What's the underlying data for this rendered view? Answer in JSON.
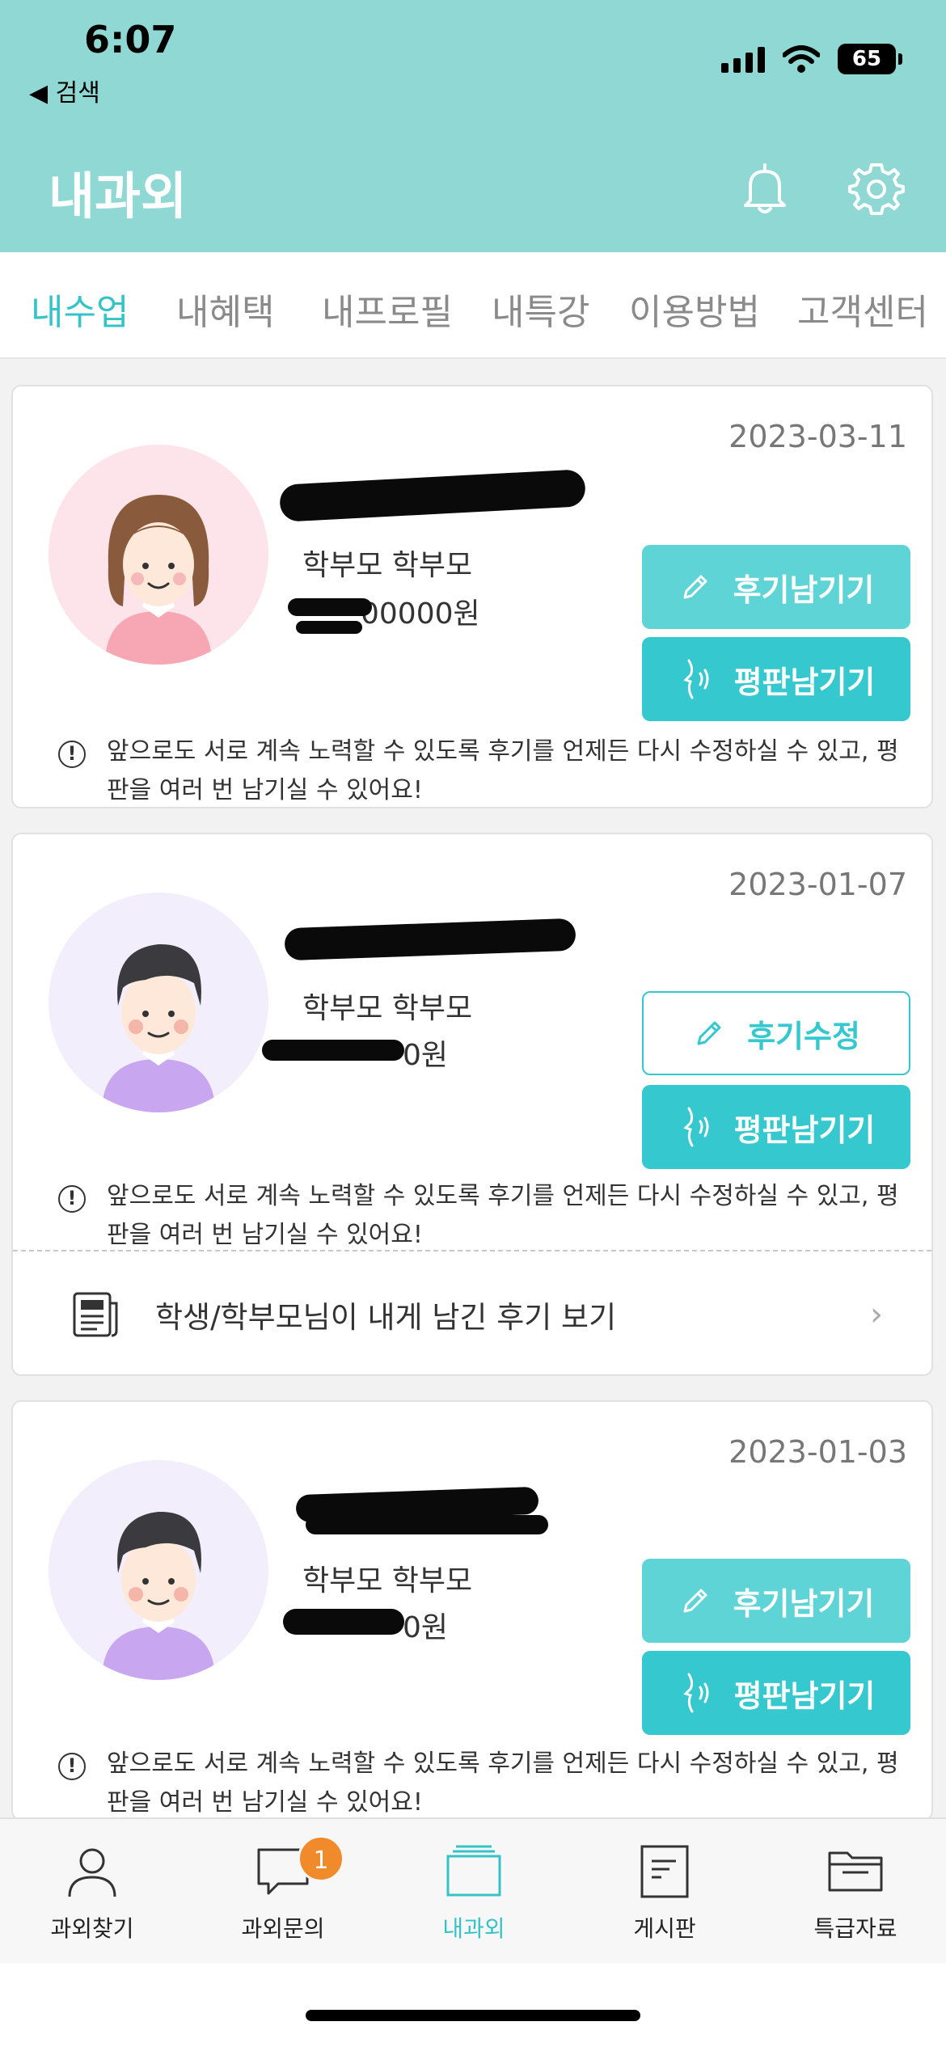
{
  "status_bar": {
    "time": "6:07",
    "back_label": "◀ 검색",
    "battery": "65"
  },
  "header": {
    "title": "내과외",
    "icons": [
      "bell-icon",
      "gear-icon"
    ]
  },
  "tabs": [
    "내수업",
    "내혜택",
    "내프로필",
    "내특강",
    "이용방법",
    "고객센터"
  ],
  "active_tab": "내수업",
  "cards": [
    {
      "date": "2023-03-11",
      "avatar": "female-student",
      "role": "학부모 학부모",
      "price_visible": "00000원",
      "buttons": [
        "후기남기기",
        "평판남기기"
      ],
      "notice": "앞으로도 서로 계속 노력할 수 있도록 후기를 언제든 다시 수정하실 수 있고, 평판을 여러 번 남기실 수 있어요!"
    },
    {
      "date": "2023-01-07",
      "avatar": "male-student",
      "role": "학부모 학부모",
      "price_visible": "0원",
      "buttons": [
        "후기수정",
        "평판남기기"
      ],
      "notice": "앞으로도 서로 계속 노력할 수 있도록 후기를 언제든 다시 수정하실 수 있고, 평판을 여러 번 남기실 수 있어요!",
      "review_link": "학생/학부모님이 내게 남긴 후기 보기"
    },
    {
      "date": "2023-01-03",
      "avatar": "male-student",
      "role": "학부모 학부모",
      "price_visible": "0원",
      "buttons": [
        "후기남기기",
        "평판남기기"
      ],
      "notice": "앞으로도 서로 계속 노력할 수 있도록 후기를 언제든 다시 수정하실 수 있고, 평판을 여러 번 남기실 수 있어요!"
    }
  ],
  "bottom_nav": [
    {
      "label": "과외찾기",
      "icon": "person-icon"
    },
    {
      "label": "과외문의",
      "icon": "chat-icon",
      "badge": "1"
    },
    {
      "label": "내과외",
      "icon": "cards-icon"
    },
    {
      "label": "게시판",
      "icon": "document-icon"
    },
    {
      "label": "특급자료",
      "icon": "folder-icon"
    }
  ],
  "colors": {
    "header": "#8fd8d3",
    "accent": "#36c3c8",
    "badge": "#f08a2a"
  }
}
